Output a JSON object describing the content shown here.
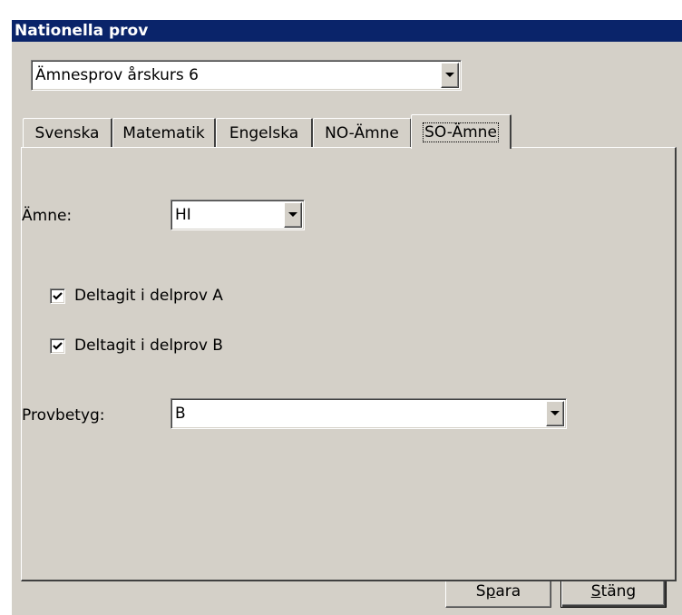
{
  "window": {
    "title": "Nationella prov"
  },
  "test_select": {
    "value": "Ämnesprov årskurs 6"
  },
  "tabs": [
    {
      "label": "Svenska"
    },
    {
      "label": "Matematik"
    },
    {
      "label": "Engelska"
    },
    {
      "label": "NO-Ämne"
    },
    {
      "label": "SO-Ämne",
      "active": true
    }
  ],
  "panel": {
    "subject_label": "Ämne:",
    "subject_value": "HI",
    "checkbox_a": {
      "label": "Deltagit i delprov A",
      "checked": true
    },
    "checkbox_b": {
      "label": "Deltagit i delprov B",
      "checked": true
    },
    "grade_label": "Provbetyg:",
    "grade_value": "B"
  },
  "buttons": {
    "save": {
      "before": "S",
      "accel": "p",
      "after": "ara"
    },
    "close": {
      "before": "",
      "accel": "S",
      "after": "täng"
    }
  },
  "icons": {
    "dropdown": "chevron-down-icon",
    "checkmark": "checkmark-icon"
  }
}
